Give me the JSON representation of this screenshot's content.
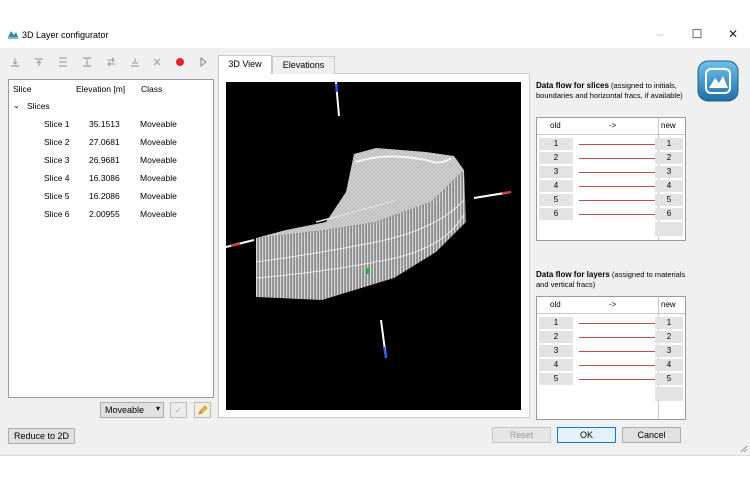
{
  "window": {
    "title": "3D Layer configurator",
    "minimize": "–",
    "maximize": "☐",
    "close": "✕"
  },
  "toolbar": {
    "icons": [
      "insert-top-icon",
      "insert-above-icon",
      "insert-below-icon",
      "insert-bottom-icon",
      "swap-icon",
      "merge-icon",
      "delete-icon",
      "record-icon",
      "play-icon"
    ]
  },
  "tree": {
    "headers": {
      "slice": "Slice",
      "elevation": "Elevation [m]",
      "class": "Class"
    },
    "group": "Slices",
    "rows": [
      {
        "name": "Slice 1",
        "elevation": "35.1513",
        "class": "Moveable"
      },
      {
        "name": "Slice 2",
        "elevation": "27.0681",
        "class": "Moveable"
      },
      {
        "name": "Slice 3",
        "elevation": "26.9681",
        "class": "Moveable"
      },
      {
        "name": "Slice 4",
        "elevation": "16.3086",
        "class": "Moveable"
      },
      {
        "name": "Slice 5",
        "elevation": "16.2086",
        "class": "Moveable"
      },
      {
        "name": "Slice 6",
        "elevation": "2.00955",
        "class": "Moveable"
      }
    ]
  },
  "class_select": {
    "value": "Moveable"
  },
  "tabs": [
    {
      "label": "3D View",
      "active": true
    },
    {
      "label": "Elevations",
      "active": false
    }
  ],
  "slices_flow": {
    "title": "Data flow for slices",
    "subtitle": " (assigned to initials, boundaries and horizontal fracs, if available)",
    "header": {
      "old": "old",
      "arrow": "->",
      "new": "new"
    },
    "rows": [
      {
        "old": "1",
        "new": "1"
      },
      {
        "old": "2",
        "new": "2"
      },
      {
        "old": "3",
        "new": "3"
      },
      {
        "old": "4",
        "new": "4"
      },
      {
        "old": "5",
        "new": "5"
      },
      {
        "old": "6",
        "new": "6"
      }
    ]
  },
  "layers_flow": {
    "title": "Data flow for layers",
    "subtitle": " (assigned to materials and vertical fracs)",
    "header": {
      "old": "old",
      "arrow": "->",
      "new": "new"
    },
    "rows": [
      {
        "old": "1",
        "new": "1"
      },
      {
        "old": "2",
        "new": "2"
      },
      {
        "old": "3",
        "new": "3"
      },
      {
        "old": "4",
        "new": "4"
      },
      {
        "old": "5",
        "new": "5"
      }
    ]
  },
  "buttons": {
    "reduce": "Reduce to 2D",
    "reset": "Reset",
    "ok": "OK",
    "cancel": "Cancel"
  },
  "colors": {
    "link_line": "#c05050",
    "accent_blue": "#3a7fc4",
    "record_red": "#e0262a"
  }
}
